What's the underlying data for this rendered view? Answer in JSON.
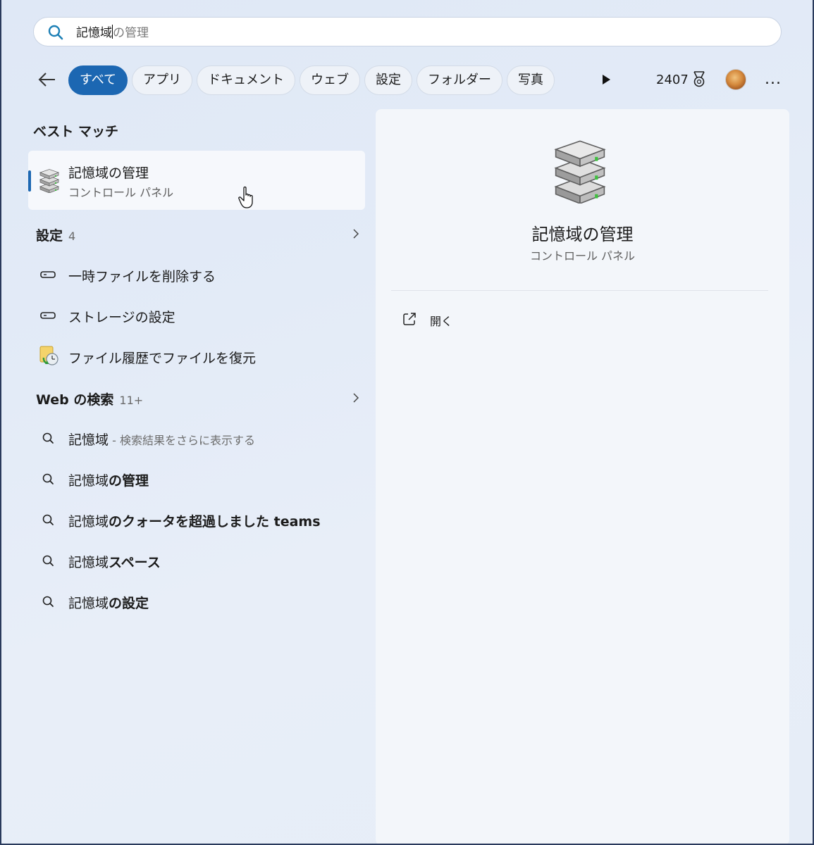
{
  "search": {
    "typed": "記憶域",
    "ghost": "の管理"
  },
  "filters": {
    "chips": [
      "すべて",
      "アプリ",
      "ドキュメント",
      "ウェブ",
      "設定",
      "フォルダー",
      "写真"
    ],
    "active_index": 0
  },
  "header": {
    "points": "2407",
    "more": "..."
  },
  "best_match": {
    "section": "ベスト マッチ",
    "title": "記憶域の管理",
    "subtitle": "コントロール パネル"
  },
  "settings_group": {
    "label": "設定",
    "count": "4",
    "items": [
      {
        "label": "一時ファイルを削除する",
        "icon": "storage-drive-icon"
      },
      {
        "label": "ストレージの設定",
        "icon": "storage-drive-icon"
      },
      {
        "label": "ファイル履歴でファイルを復元",
        "icon": "file-history-icon"
      }
    ]
  },
  "web_group": {
    "label": "Web の検索",
    "count": "11+",
    "items": [
      {
        "prefix": "記憶域",
        "bold": "",
        "hint": " - 検索結果をさらに表示する"
      },
      {
        "prefix": "記憶域",
        "bold": "の管理",
        "hint": ""
      },
      {
        "prefix": "記憶域",
        "bold": "のクォータを超過しました teams",
        "hint": ""
      },
      {
        "prefix": "記憶域",
        "bold": "スペース",
        "hint": ""
      },
      {
        "prefix": "記憶域",
        "bold": "の設定",
        "hint": ""
      }
    ]
  },
  "detail": {
    "title": "記憶域の管理",
    "subtitle": "コントロール パネル",
    "open_label": "開く"
  },
  "colors": {
    "accent": "#1c67b2"
  }
}
